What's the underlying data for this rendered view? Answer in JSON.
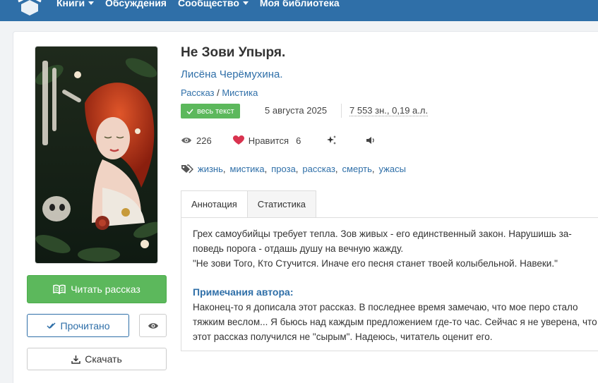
{
  "nav": {
    "items": [
      {
        "label": "Книги",
        "has_caret": true
      },
      {
        "label": "Обсуждения",
        "has_caret": false
      },
      {
        "label": "Сообщество",
        "has_caret": true
      },
      {
        "label": "Моя библиотека",
        "has_caret": false
      }
    ]
  },
  "book": {
    "title": "Не Зови Упыря.",
    "author": "Лисёна Черёмухина.",
    "genre_1": "Рассказ",
    "genre_sep": " / ",
    "genre_2": "Мистика",
    "badge": "весь текст",
    "date": "5 августа 2025",
    "size": "7 553 зн., 0,19 а.л."
  },
  "stats": {
    "views": "226",
    "likes_label": "Нравится",
    "likes_count": "6"
  },
  "tags": [
    "жизнь",
    "мистика",
    "проза",
    "рассказ",
    "смерть",
    "ужасы"
  ],
  "tabs": [
    {
      "label": "Аннотация",
      "active": true
    },
    {
      "label": "Статистика",
      "active": false
    }
  ],
  "annotation": {
    "line_1": "Грех самоубийцы требует тепла. Зов живых - его единственный закон. Нарушишь за-",
    "line_2": "поведь порога - отдашь душу на вечную жажду.",
    "line_3": "\"Не зови Того, Кто Стучится. Иначе его песня станет твоей колыбельной. Навеки.\"",
    "notes_title": "Примечания автора:",
    "notes_1": "Наконец-то я дописала этот рассказ. В последнее время замечаю, что мое перо стало",
    "notes_2": "тяжким веслом... Я бьюсь над каждым предложением где-то час. Сейчас я не уверена,",
    "notes_3": "что этот рассказ получился не \"сырым\". Надеюсь, читатель оценит его."
  },
  "buttons": {
    "read": "Читать рассказ",
    "done": "Прочитано",
    "download": "Скачать"
  },
  "colors": {
    "brand": "#2f6fa8",
    "accent_green": "#5cb85c",
    "heart": "#d9334f"
  },
  "icons": {
    "logo": "book-stack-logo",
    "read": "open-book-icon",
    "done": "double-check-icon",
    "eye": "eye-icon",
    "download": "download-icon",
    "views": "eye-icon",
    "like": "heart-icon",
    "sparkle": "sparkle-icon",
    "audio": "speaker-icon",
    "tags": "tags-icon",
    "badge": "check-icon"
  }
}
